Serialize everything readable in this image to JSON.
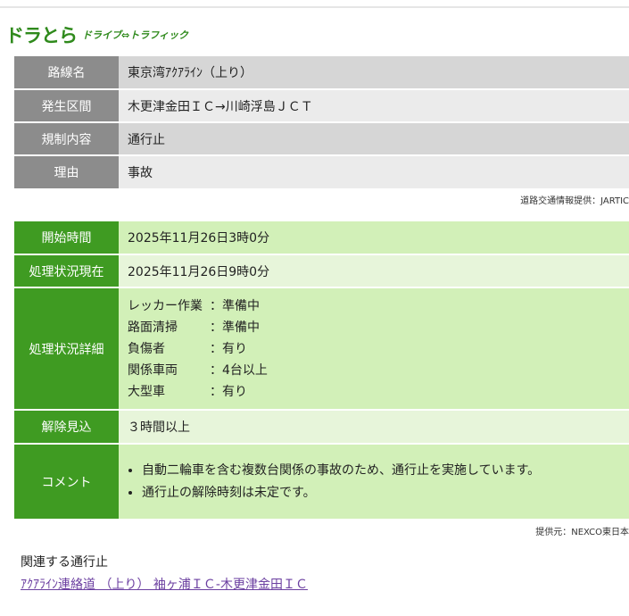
{
  "logo": {
    "main": "ドラとら",
    "sub": "ドライブ⇔トラフィック"
  },
  "info": [
    {
      "label": "路線名",
      "value": "東京湾ｱｸｱﾗｲﾝ（上り）"
    },
    {
      "label": "発生区間",
      "value": "木更津金田ＩＣ→川崎浮島ＪＣＴ"
    },
    {
      "label": "規制内容",
      "value": "通行止"
    },
    {
      "label": "理由",
      "value": "事故"
    }
  ],
  "info_source": "道路交通情報提供：JARTIC",
  "status": {
    "start": {
      "label": "開始時間",
      "value": "2025年11月26日3時0分"
    },
    "current": {
      "label": "処理状況現在",
      "value": "2025年11月26日9時0分"
    },
    "detail": {
      "label": "処理状況詳細",
      "items": [
        {
          "k": "レッカー作業",
          "v": "：準備中"
        },
        {
          "k": "路面清掃",
          "v": "：準備中"
        },
        {
          "k": "負傷者",
          "v": "：有り"
        },
        {
          "k": "関係車両",
          "v": "：4台以上"
        },
        {
          "k": "大型車",
          "v": "：有り"
        }
      ]
    },
    "release": {
      "label": "解除見込",
      "value": "３時間以上"
    },
    "comment": {
      "label": "コメント",
      "items": [
        "自動二輪車を含む複数台関係の事故のため、通行止を実施しています。",
        "通行止の解除時刻は未定です。"
      ]
    }
  },
  "status_source": "提供元：NEXCO東日本",
  "related": {
    "title": "関連する通行止",
    "link": "ｱｸｱﾗｲﾝ連絡道 （上り） 袖ヶ浦ＩＣ-木更津金田ＩＣ"
  }
}
